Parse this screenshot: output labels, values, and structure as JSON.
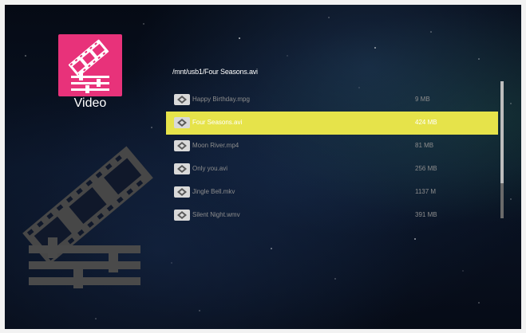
{
  "category": {
    "title": "Video",
    "icon": "video-film-icon",
    "tile_color": "#e8327a"
  },
  "browser": {
    "path": "/mnt/usb1/Four Seasons.avi",
    "highlight_color": "#e6e34a",
    "files": [
      {
        "name": "Happy Birthday.mpg",
        "size": "9  MB",
        "icon": "video-file-icon",
        "selected": false
      },
      {
        "name": "Four Seasons.avi",
        "size": "424  MB",
        "icon": "video-file-icon",
        "selected": true
      },
      {
        "name": "Moon River.mp4",
        "size": "81  MB",
        "icon": "video-file-icon",
        "selected": false
      },
      {
        "name": "Only you.avi",
        "size": "256  MB",
        "icon": "video-file-icon",
        "selected": false
      },
      {
        "name": "Jingle Bell.mkv",
        "size": "1137  M",
        "icon": "video-file-icon",
        "selected": false
      },
      {
        "name": "Silent Night.wmv",
        "size": "391  MB",
        "icon": "video-file-icon",
        "selected": false
      }
    ]
  }
}
